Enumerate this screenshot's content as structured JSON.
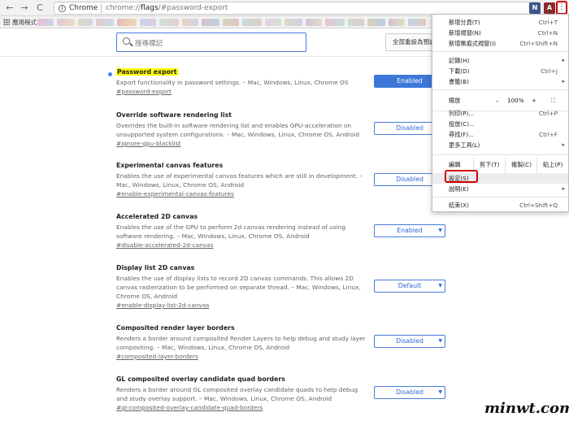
{
  "toolbar": {
    "back_icon": "←",
    "forward_icon": "→",
    "reload_icon": "C",
    "scheme_label": "Chrome",
    "url_prefix": "chrome://",
    "url_host": "flags",
    "url_rest": "/#password-export",
    "star_icon": "☆",
    "ext1_label": "N",
    "ext2_label": "A",
    "menu_icon": "⋮"
  },
  "bookmarks": {
    "apps_label": "應用程式"
  },
  "flags_page": {
    "search_placeholder": "搜尋標記",
    "reset_label": "全部重設為預設"
  },
  "flags": [
    {
      "title": "Password export",
      "desc": "Export functionality in password settings. – Mac, Windows, Linux, Chrome OS",
      "link": "#password-export",
      "value": "Enabled"
    },
    {
      "title": "Override software rendering list",
      "desc": "Overrides the built-in software rendering list and enables GPU-acceleration on unsupported system configurations. – Mac, Windows, Linux, Chrome OS, Android",
      "link": "#ignore-gpu-blacklist",
      "value": "Disabled"
    },
    {
      "title": "Experimental canvas features",
      "desc": "Enables the use of experimental canvas features which are still in development. – Mac, Windows, Linux, Chrome OS, Android",
      "link": "#enable-experimental-canvas-features",
      "value": "Disabled"
    },
    {
      "title": "Accelerated 2D canvas",
      "desc": "Enables the use of the GPU to perform 2d canvas rendering instead of using software rendering. – Mac, Windows, Linux, Chrome OS, Android",
      "link": "#disable-accelerated-2d-canvas",
      "value": "Enabled"
    },
    {
      "title": "Display list 2D canvas",
      "desc": "Enables the use of display lists to record 2D canvas commands. This allows 2D canvas rasterization to be performed on separate thread. – Mac, Windows, Linux, Chrome OS, Android",
      "link": "#enable-display-list-2d-canvas",
      "value": "Default"
    },
    {
      "title": "Composited render layer borders",
      "desc": "Renders a border around composited Render Layers to help debug and study layer compositing. – Mac, Windows, Linux, Chrome OS, Android",
      "link": "#composited-layer-borders",
      "value": "Disabled"
    },
    {
      "title": "GL composited overlay candidate quad borders",
      "desc": "Renders a border around GL composited overlay candidate quads to help debug and study overlay support. – Mac, Windows, Linux, Chrome OS, Android",
      "link": "#gl-composited-overlay-candidate-quad-borders",
      "value": "Disabled"
    }
  ],
  "menu": {
    "new_tab": "新增分頁(T)",
    "new_tab_sc": "Ctrl+T",
    "new_window": "新增視窗(N)",
    "new_window_sc": "Ctrl+N",
    "incognito": "新增無痕式視窗(I)",
    "incognito_sc": "Ctrl+Shift+N",
    "history": "記錄(H)",
    "downloads": "下載(D)",
    "downloads_sc": "Ctrl+J",
    "bookmarks": "書籤(B)",
    "zoom_label": "縮放",
    "zoom_minus": "–",
    "zoom_value": "100%",
    "zoom_plus": "+",
    "fullscreen_icon": "⛶",
    "print": "列印(P)...",
    "print_sc": "Ctrl+P",
    "cast": "投放(C)...",
    "find": "尋找(F)...",
    "find_sc": "Ctrl+F",
    "more_tools": "更多工具(L)",
    "edit_label": "編輯",
    "cut": "剪下(T)",
    "copy": "複製(C)",
    "paste": "貼上(P)",
    "settings": "設定(S)",
    "help": "說明(E)",
    "exit": "結束(X)",
    "exit_sc": "Ctrl+Shift+Q",
    "submenu_arrow": "▸"
  },
  "watermark": "minwt.com",
  "colors": {
    "accent": "#4a7bd8",
    "highlight_red": "#d40000",
    "flag_highlight": "#ffff00"
  }
}
